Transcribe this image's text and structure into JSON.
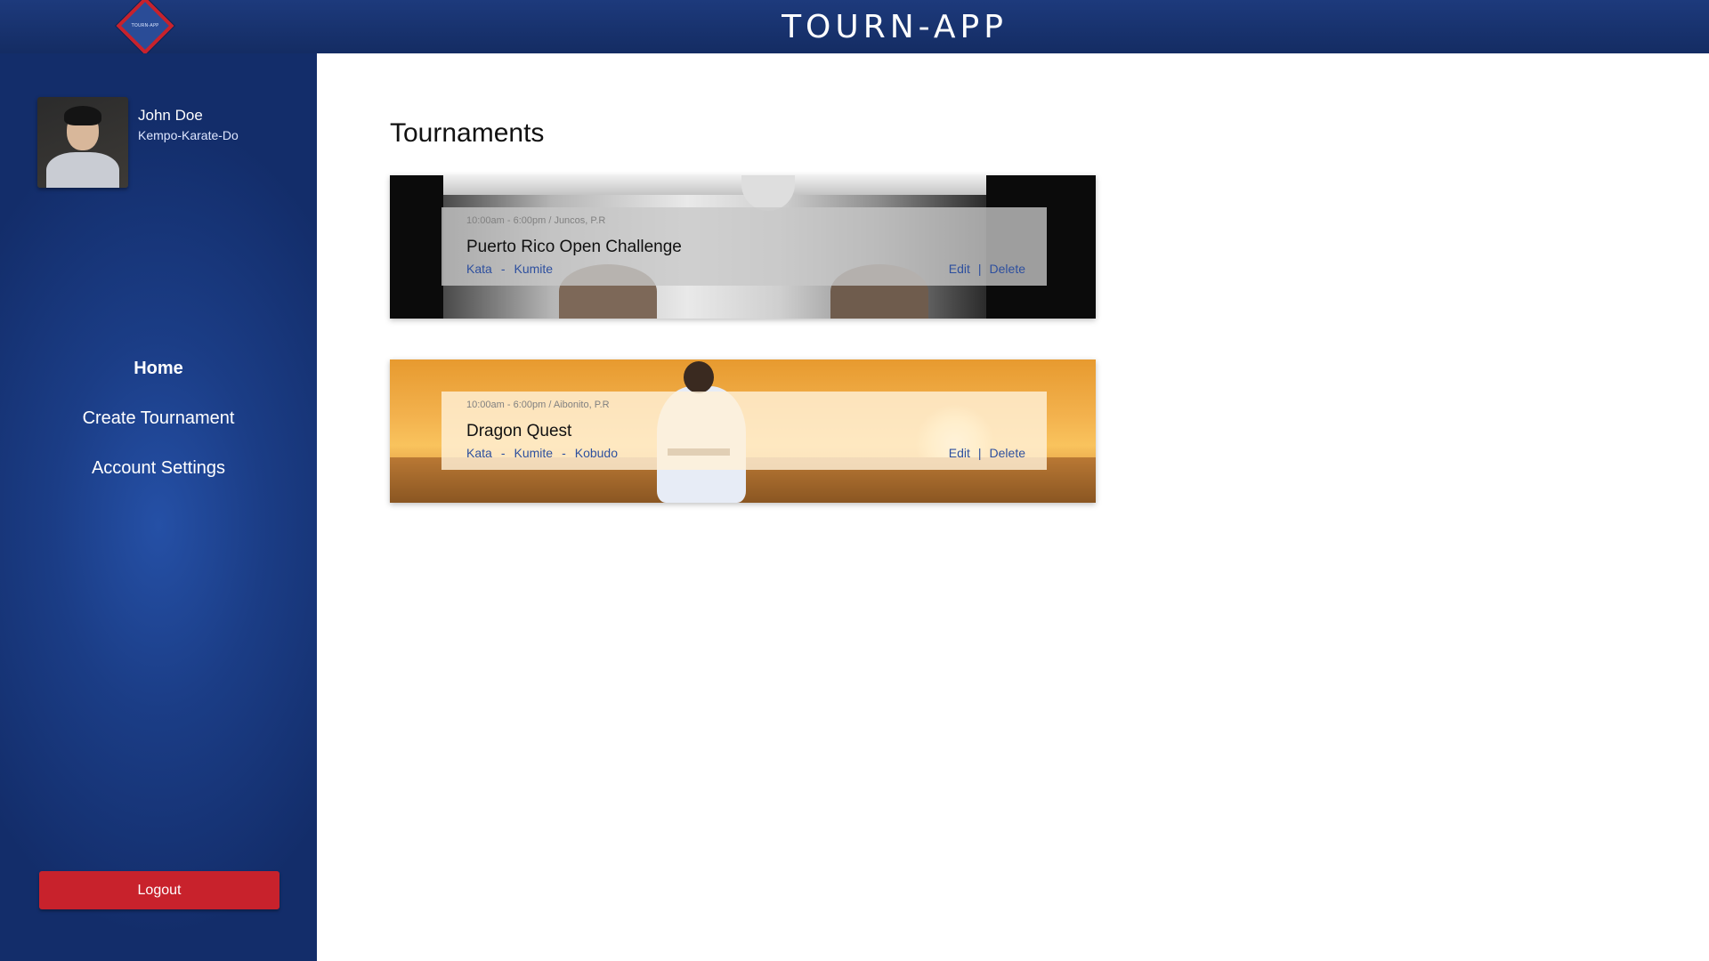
{
  "header": {
    "app_title": "TOURN-APP",
    "logo_text": "TOURN-APP"
  },
  "sidebar": {
    "user": {
      "name": "John Doe",
      "style": "Kempo-Karate-Do"
    },
    "nav": [
      {
        "label": "Home",
        "active": true
      },
      {
        "label": "Create Tournament",
        "active": false
      },
      {
        "label": "Account Settings",
        "active": false
      }
    ],
    "logout_label": "Logout"
  },
  "main": {
    "title": "Tournaments",
    "tournaments": [
      {
        "meta": "10:00am - 6:00pm / Juncos, P.R",
        "name": "Puerto Rico Open Challenge",
        "categories": [
          "Kata",
          "Kumite"
        ],
        "edit_label": "Edit",
        "divider": "|",
        "delete_label": "Delete"
      },
      {
        "meta": "10:00am - 6:00pm / Aibonito, P.R",
        "name": "Dragon Quest",
        "categories": [
          "Kata",
          "Kumite",
          "Kobudo"
        ],
        "edit_label": "Edit",
        "divider": "|",
        "delete_label": "Delete"
      }
    ],
    "category_separator": "-"
  },
  "colors": {
    "header_bg": "#142c63",
    "sidebar_bg": "#1b3d86",
    "accent_red": "#c8222c",
    "link_blue": "#2d4f9e"
  }
}
